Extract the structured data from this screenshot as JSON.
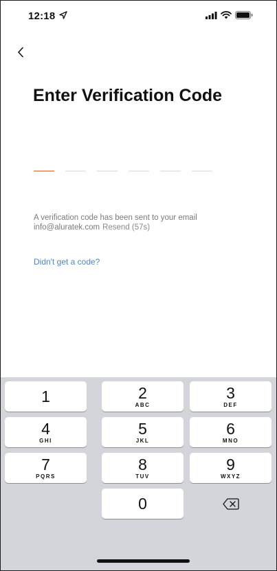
{
  "status_bar": {
    "time": "12:18",
    "icons": [
      "location-arrow-icon",
      "signal-icon",
      "wifi-icon",
      "battery-icon"
    ]
  },
  "nav": {
    "back_icon": "chevron-left-icon"
  },
  "page": {
    "title": "Enter Verification Code",
    "code_length": 6,
    "active_slot_color": "#f0a070",
    "inactive_slot_color": "#e9e9ec",
    "info_line1": "A verification code has been sent to your email",
    "email": "info@aluratek.com",
    "resend_label": "Resend (57s)",
    "no_code_link": "Didn't get a code?",
    "link_color": "#4a86c8"
  },
  "keypad": {
    "keys": [
      {
        "digit": "1",
        "letters": ""
      },
      {
        "digit": "2",
        "letters": "ABC"
      },
      {
        "digit": "3",
        "letters": "DEF"
      },
      {
        "digit": "4",
        "letters": "GHI"
      },
      {
        "digit": "5",
        "letters": "JKL"
      },
      {
        "digit": "6",
        "letters": "MNO"
      },
      {
        "digit": "7",
        "letters": "PQRS"
      },
      {
        "digit": "8",
        "letters": "TUV"
      },
      {
        "digit": "9",
        "letters": "WXYZ"
      },
      {
        "digit": "0",
        "letters": ""
      }
    ],
    "delete_icon": "backspace-icon"
  }
}
